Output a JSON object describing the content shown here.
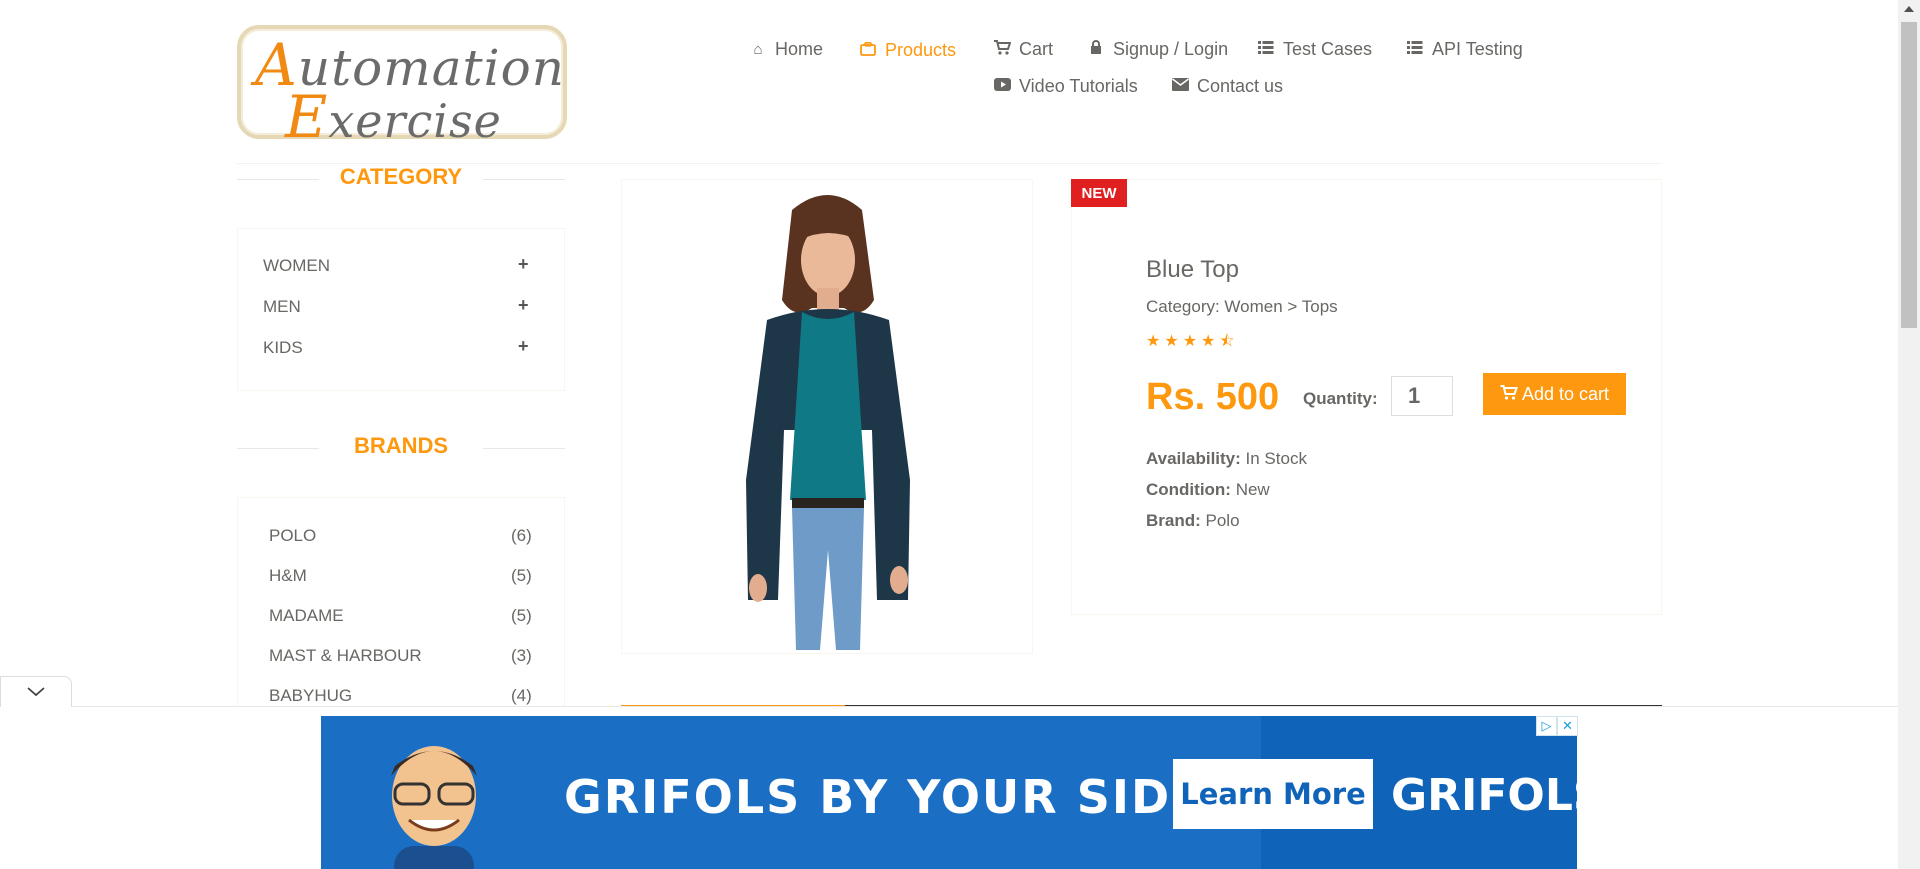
{
  "logo": {
    "line1_cap": "A",
    "line1_rest": "utomation",
    "line2_cap": "E",
    "line2_rest": "xercise"
  },
  "nav": {
    "home": "Home",
    "products": "Products",
    "cart": "Cart",
    "signup": "Signup / Login",
    "test_cases": "Test Cases",
    "api_testing": "API Testing",
    "video": "Video Tutorials",
    "contact": "Contact us"
  },
  "sidebar": {
    "category_title": "CATEGORY",
    "categories": [
      "WOMEN",
      "MEN",
      "KIDS"
    ],
    "brands_title": "BRANDS",
    "brands": [
      {
        "name": "POLO",
        "count": "(6)"
      },
      {
        "name": "H&M",
        "count": "(5)"
      },
      {
        "name": "MADAME",
        "count": "(5)"
      },
      {
        "name": "MAST & HARBOUR",
        "count": "(3)"
      },
      {
        "name": "BABYHUG",
        "count": "(4)"
      }
    ]
  },
  "product": {
    "badge": "NEW",
    "name": "Blue Top",
    "category": "Category: Women > Tops",
    "rating": 4.5,
    "price": "Rs. 500",
    "quantity_label": "Quantity:",
    "quantity_value": "1",
    "add_to_cart": "Add to cart",
    "availability_label": "Availability:",
    "availability": "In Stock",
    "condition_label": "Condition:",
    "condition": "New",
    "brand_label": "Brand:",
    "brand": "Polo"
  },
  "ad": {
    "headline": "GRIFOLS BY YOUR SIDE",
    "cta": "Learn More",
    "brand": "GRIFOLS"
  },
  "colors": {
    "accent": "#fe980f",
    "badge": "#e02020",
    "ad_blue": "#0f63b8",
    "text": "#696763"
  }
}
